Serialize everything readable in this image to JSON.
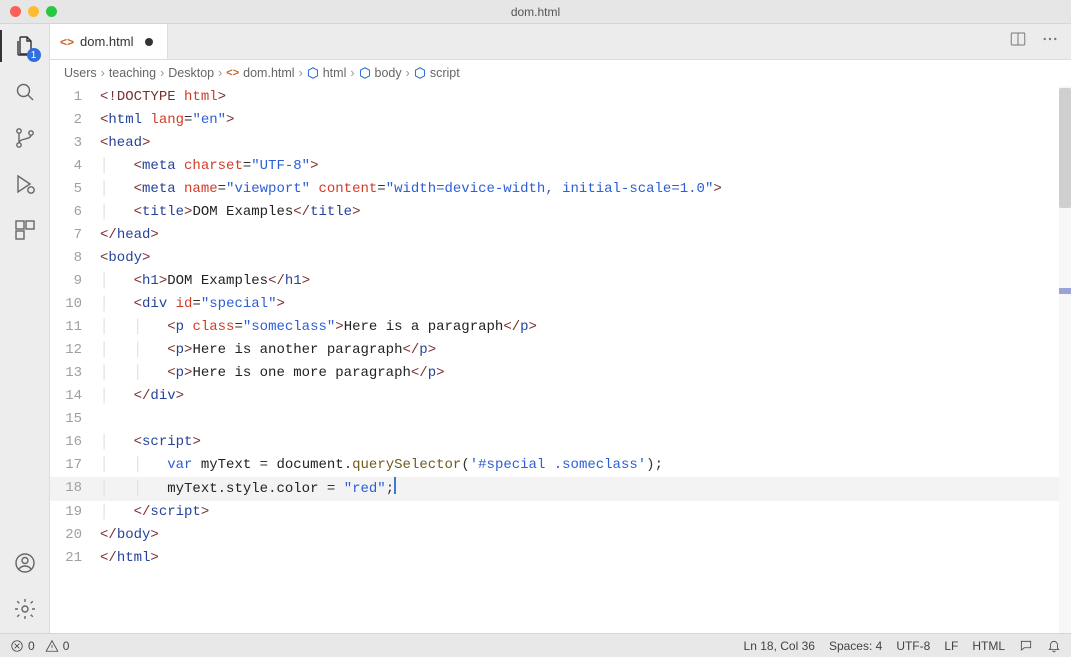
{
  "window": {
    "title": "dom.html"
  },
  "activitybar": {
    "explorer_badge": "1"
  },
  "tab": {
    "icon_label": "<>",
    "name": "dom.html",
    "dirty": true
  },
  "breadcrumbs": {
    "s0": "Users",
    "s1": "teaching",
    "s2": "Desktop",
    "file": "dom.html",
    "sym0": "html",
    "sym1": "body",
    "sym2": "script"
  },
  "code": {
    "lines": [
      {
        "n": 1,
        "html": "<span class='c-punc'>&lt;!</span><span class='c-doctype'>DOCTYPE</span> <span class='c-attr'>html</span><span class='c-punc'>&gt;</span>"
      },
      {
        "n": 2,
        "html": "<span class='c-punc'>&lt;</span><span class='c-tag'>html</span> <span class='c-attr'>lang</span>=<span class='c-str'>\"en\"</span><span class='c-punc'>&gt;</span>"
      },
      {
        "n": 3,
        "html": "<span class='c-punc'>&lt;</span><span class='c-tag'>head</span><span class='c-punc'>&gt;</span>"
      },
      {
        "n": 4,
        "html": "    <span class='c-punc'>&lt;</span><span class='c-tag'>meta</span> <span class='c-attr'>charset</span>=<span class='c-str'>\"UTF-8\"</span><span class='c-punc'>&gt;</span>"
      },
      {
        "n": 5,
        "html": "    <span class='c-punc'>&lt;</span><span class='c-tag'>meta</span> <span class='c-attr'>name</span>=<span class='c-str'>\"viewport\"</span> <span class='c-attr'>content</span>=<span class='c-str'>\"width=device-width, initial-scale=1.0\"</span><span class='c-punc'>&gt;</span>"
      },
      {
        "n": 6,
        "html": "    <span class='c-punc'>&lt;</span><span class='c-tag'>title</span><span class='c-punc'>&gt;</span><span class='c-text'>DOM Examples</span><span class='c-punc'>&lt;/</span><span class='c-tag'>title</span><span class='c-punc'>&gt;</span>"
      },
      {
        "n": 7,
        "html": "<span class='c-punc'>&lt;/</span><span class='c-tag'>head</span><span class='c-punc'>&gt;</span>"
      },
      {
        "n": 8,
        "html": "<span class='c-punc'>&lt;</span><span class='c-tag'>body</span><span class='c-punc'>&gt;</span>"
      },
      {
        "n": 9,
        "html": "    <span class='c-punc'>&lt;</span><span class='c-tag'>h1</span><span class='c-punc'>&gt;</span><span class='c-text'>DOM Examples</span><span class='c-punc'>&lt;/</span><span class='c-tag'>h1</span><span class='c-punc'>&gt;</span>"
      },
      {
        "n": 10,
        "html": "    <span class='c-punc'>&lt;</span><span class='c-tag'>div</span> <span class='c-attr'>id</span>=<span class='c-str'>\"special\"</span><span class='c-punc'>&gt;</span>"
      },
      {
        "n": 11,
        "html": "        <span class='c-punc'>&lt;</span><span class='c-tag'>p</span> <span class='c-attr'>class</span>=<span class='c-str'>\"someclass\"</span><span class='c-punc'>&gt;</span><span class='c-text'>Here is a paragraph</span><span class='c-punc'>&lt;/</span><span class='c-tag'>p</span><span class='c-punc'>&gt;</span>"
      },
      {
        "n": 12,
        "html": "        <span class='c-punc'>&lt;</span><span class='c-tag'>p</span><span class='c-punc'>&gt;</span><span class='c-text'>Here is another paragraph</span><span class='c-punc'>&lt;/</span><span class='c-tag'>p</span><span class='c-punc'>&gt;</span>"
      },
      {
        "n": 13,
        "html": "        <span class='c-punc'>&lt;</span><span class='c-tag'>p</span><span class='c-punc'>&gt;</span><span class='c-text'>Here is one more paragraph</span><span class='c-punc'>&lt;/</span><span class='c-tag'>p</span><span class='c-punc'>&gt;</span>"
      },
      {
        "n": 14,
        "html": "    <span class='c-punc'>&lt;/</span><span class='c-tag'>div</span><span class='c-punc'>&gt;</span>"
      },
      {
        "n": 15,
        "html": ""
      },
      {
        "n": 16,
        "html": "    <span class='c-punc'>&lt;</span><span class='c-tag'>script</span><span class='c-punc'>&gt;</span>"
      },
      {
        "n": 17,
        "html": "        <span class='c-kw'>var</span> <span class='c-text'>myText</span> = <span class='c-text'>document</span>.<span class='c-func'>querySelector</span>(<span class='c-str'>'#special .someclass'</span>);"
      },
      {
        "n": 18,
        "html": "        <span class='c-text'>myText</span>.<span class='c-text'>style</span>.<span class='c-text'>color</span> = <span class='c-str'>\"red\"</span>;",
        "current": true,
        "cursorAfter": true
      },
      {
        "n": 19,
        "html": "    <span class='c-punc'>&lt;/</span><span class='c-tag'>script</span><span class='c-punc'>&gt;</span>"
      },
      {
        "n": 20,
        "html": "<span class='c-punc'>&lt;/</span><span class='c-tag'>body</span><span class='c-punc'>&gt;</span>"
      },
      {
        "n": 21,
        "html": "<span class='c-punc'>&lt;/</span><span class='c-tag'>html</span><span class='c-punc'>&gt;</span>"
      }
    ]
  },
  "status": {
    "errors": "0",
    "warnings": "0",
    "ln_col": "Ln 18, Col 36",
    "spaces": "Spaces: 4",
    "encoding": "UTF-8",
    "eol": "LF",
    "language": "HTML"
  }
}
